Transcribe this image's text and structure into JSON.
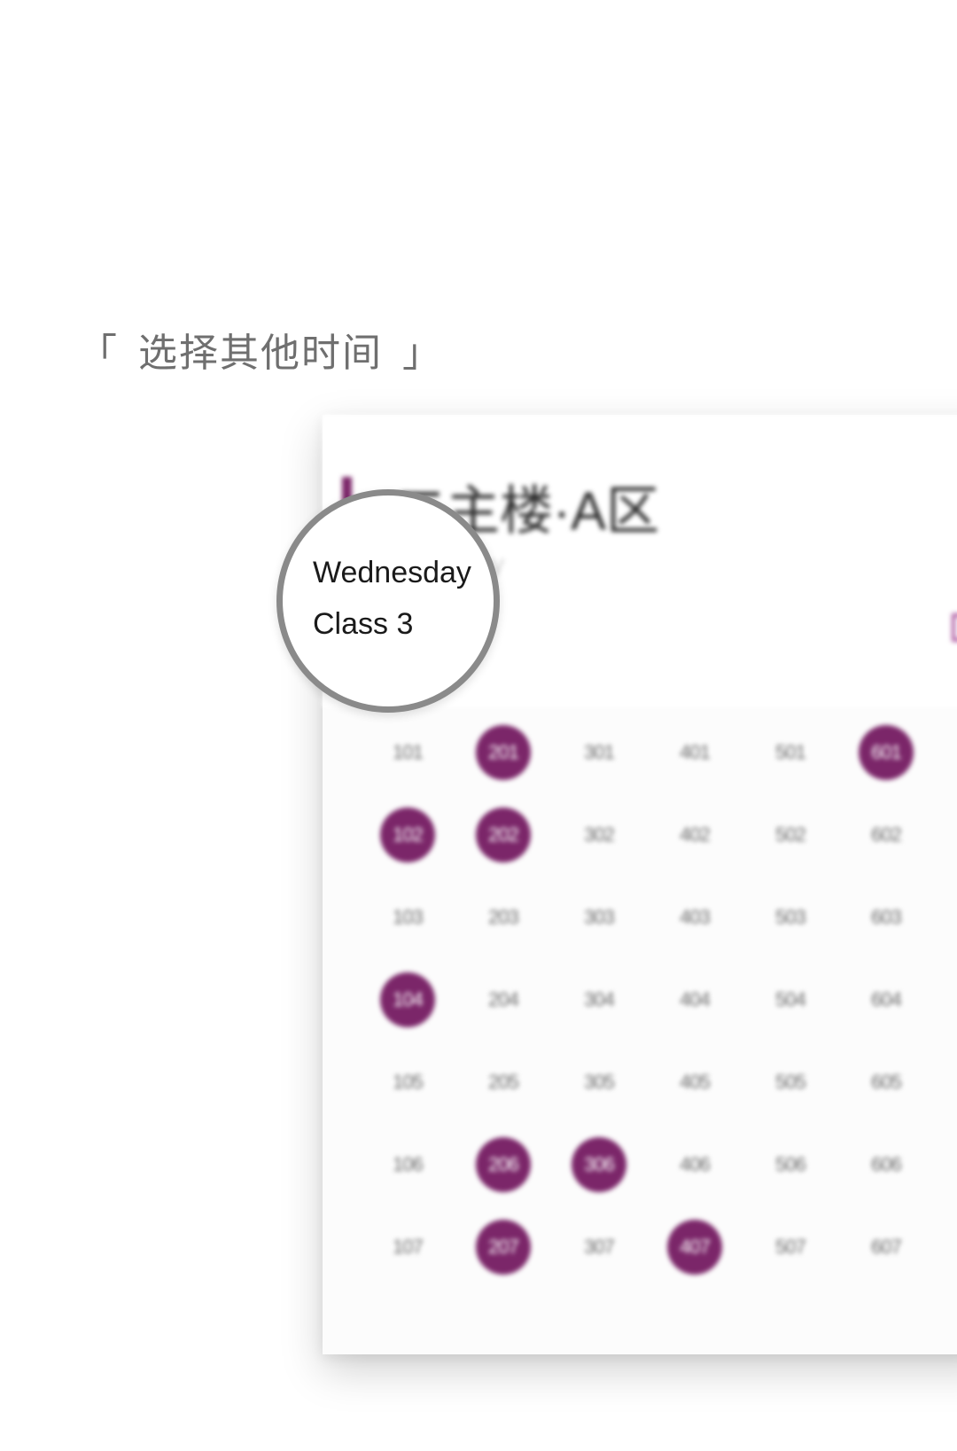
{
  "caption": {
    "open_bracket": "「",
    "text": "选择其他时间",
    "close_bracket": "」"
  },
  "card": {
    "title": "二主楼·A区",
    "ghost_subtitle": "y",
    "icon": "layout-toggle-icon"
  },
  "magnifier": {
    "day": "Wednesday",
    "class": "Class 3"
  },
  "colors": {
    "accent": "#7b2669",
    "icon_outline": "#b05fa4",
    "caption_text": "#6f6f6f"
  },
  "rooms": [
    {
      "label": "101",
      "booked": false
    },
    {
      "label": "201",
      "booked": true
    },
    {
      "label": "301",
      "booked": false
    },
    {
      "label": "401",
      "booked": false
    },
    {
      "label": "501",
      "booked": false
    },
    {
      "label": "601",
      "booked": true
    },
    {
      "label": "102",
      "booked": true
    },
    {
      "label": "202",
      "booked": true
    },
    {
      "label": "302",
      "booked": false
    },
    {
      "label": "402",
      "booked": false
    },
    {
      "label": "502",
      "booked": false
    },
    {
      "label": "602",
      "booked": false
    },
    {
      "label": "103",
      "booked": false
    },
    {
      "label": "203",
      "booked": false
    },
    {
      "label": "303",
      "booked": false
    },
    {
      "label": "403",
      "booked": false
    },
    {
      "label": "503",
      "booked": false
    },
    {
      "label": "603",
      "booked": false
    },
    {
      "label": "104",
      "booked": true
    },
    {
      "label": "204",
      "booked": false
    },
    {
      "label": "304",
      "booked": false
    },
    {
      "label": "404",
      "booked": false
    },
    {
      "label": "504",
      "booked": false
    },
    {
      "label": "604",
      "booked": false
    },
    {
      "label": "105",
      "booked": false
    },
    {
      "label": "205",
      "booked": false
    },
    {
      "label": "305",
      "booked": false
    },
    {
      "label": "405",
      "booked": false
    },
    {
      "label": "505",
      "booked": false
    },
    {
      "label": "605",
      "booked": false
    },
    {
      "label": "106",
      "booked": false
    },
    {
      "label": "206",
      "booked": true
    },
    {
      "label": "306",
      "booked": true
    },
    {
      "label": "406",
      "booked": false
    },
    {
      "label": "506",
      "booked": false
    },
    {
      "label": "606",
      "booked": false
    },
    {
      "label": "107",
      "booked": false
    },
    {
      "label": "207",
      "booked": true
    },
    {
      "label": "307",
      "booked": false
    },
    {
      "label": "407",
      "booked": true
    },
    {
      "label": "507",
      "booked": false
    },
    {
      "label": "607",
      "booked": false
    }
  ]
}
